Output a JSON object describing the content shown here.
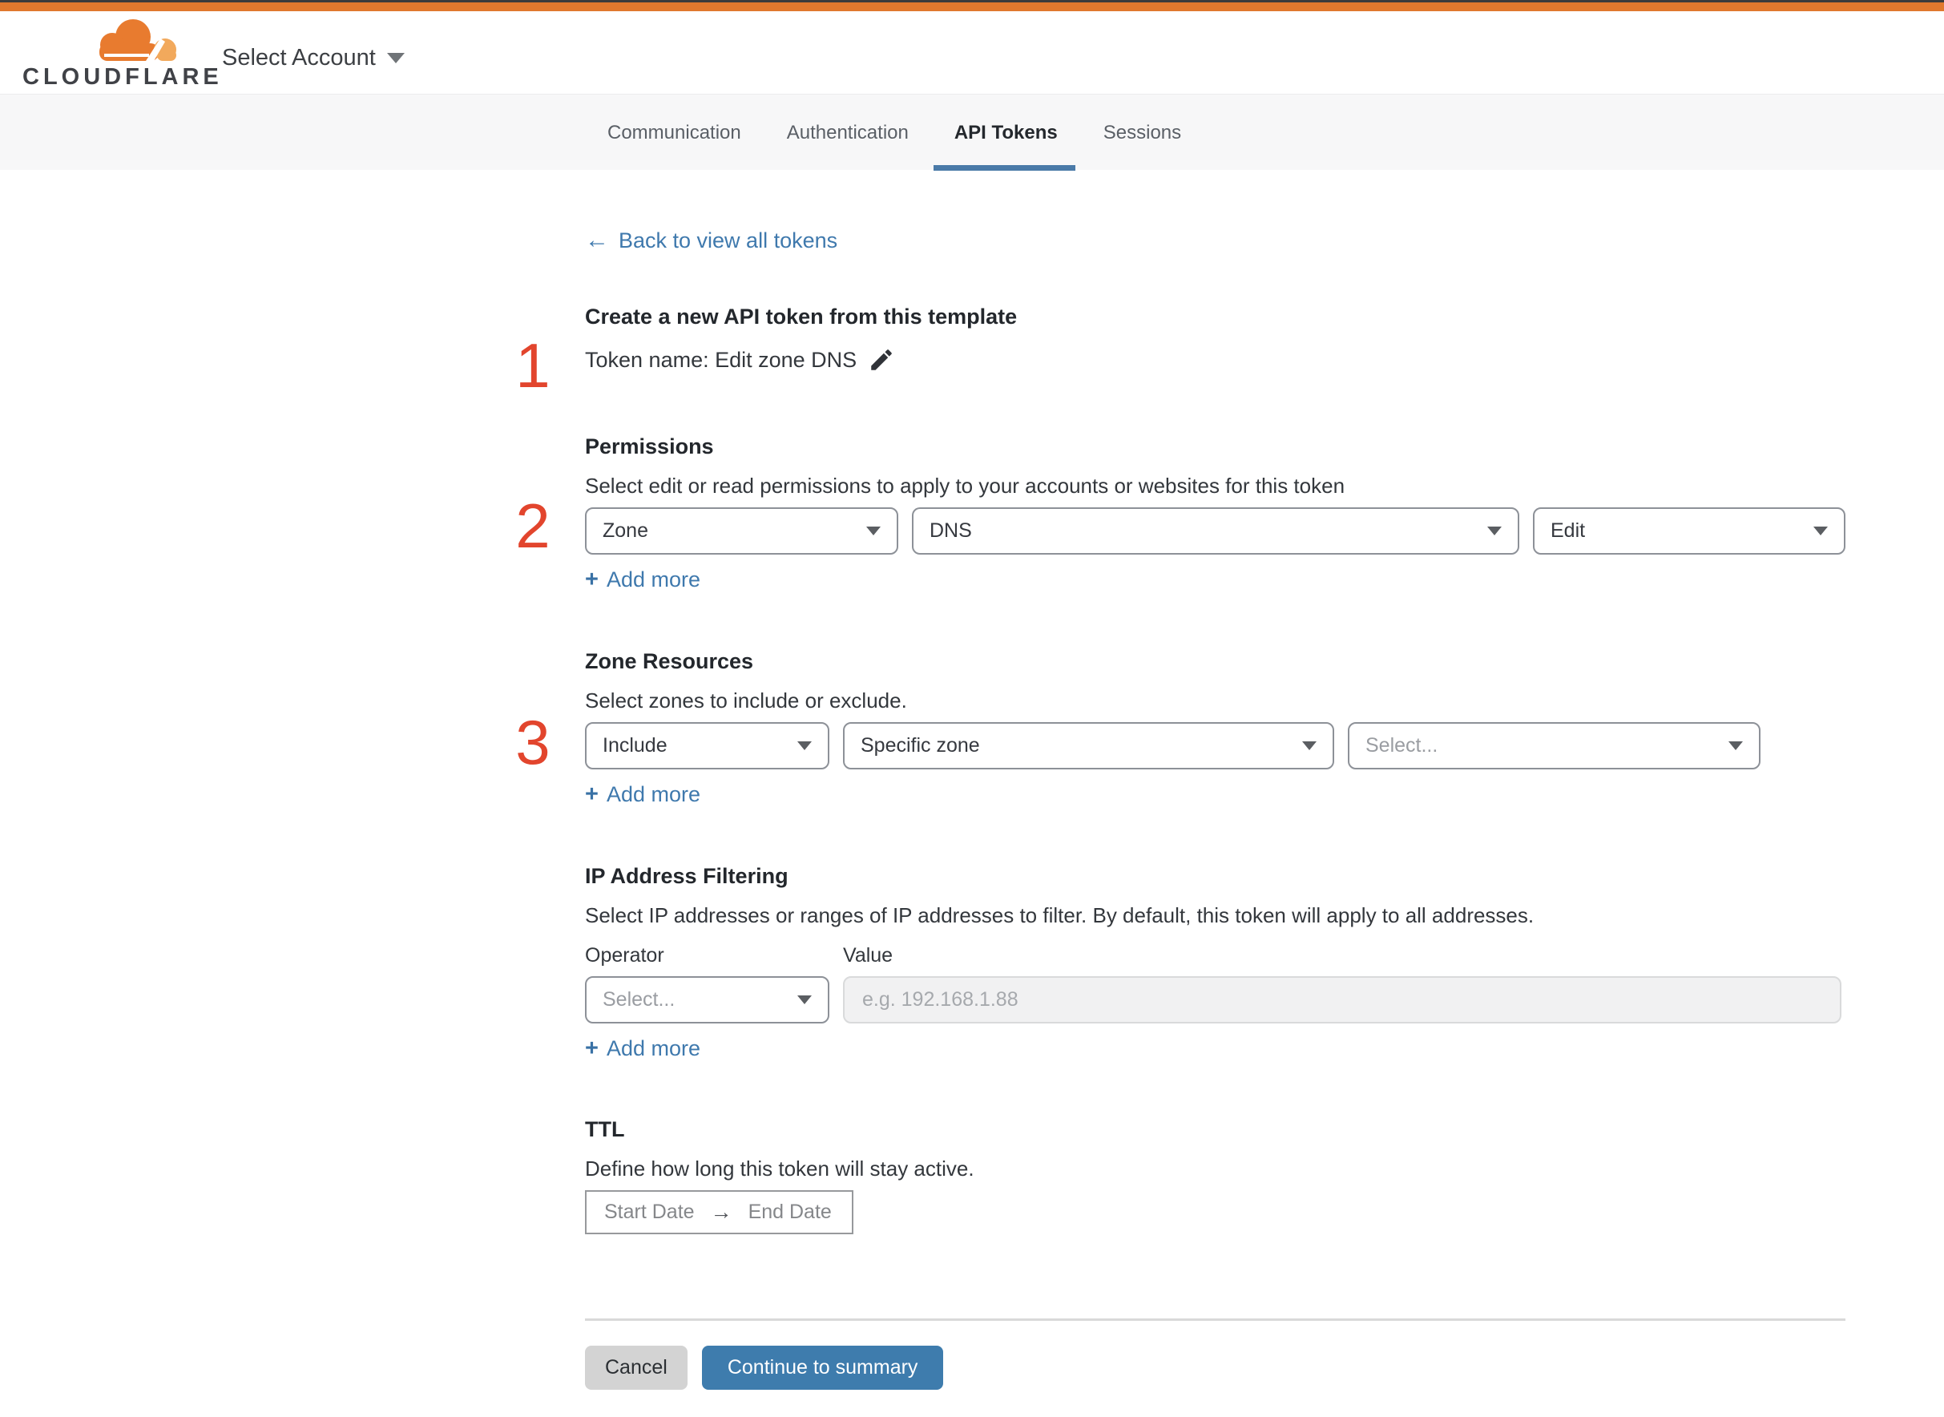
{
  "header": {
    "logo_text": "CLOUDFLARE",
    "account_selector_label": "Select Account"
  },
  "tabs": [
    {
      "label": "Communication",
      "active": false
    },
    {
      "label": "Authentication",
      "active": false
    },
    {
      "label": "API Tokens",
      "active": true
    },
    {
      "label": "Sessions",
      "active": false
    }
  ],
  "back_link": {
    "label": "Back to view all tokens"
  },
  "glyphs": {
    "back_arrow": "←",
    "plus": "+",
    "range_arrow": "→"
  },
  "token_section": {
    "step": "1",
    "title": "Create a new API token from this template",
    "token_name_line": "Token name: Edit zone DNS"
  },
  "permissions": {
    "step": "2",
    "title": "Permissions",
    "description": "Select edit or read permissions to apply to your accounts or websites for this token",
    "scope_value": "Zone",
    "resource_value": "DNS",
    "access_value": "Edit",
    "add_more_label": "Add more"
  },
  "zone_resources": {
    "step": "3",
    "title": "Zone Resources",
    "description": "Select zones to include or exclude.",
    "mode_value": "Include",
    "type_value": "Specific zone",
    "zone_placeholder": "Select...",
    "add_more_label": "Add more"
  },
  "ip_filtering": {
    "title": "IP Address Filtering",
    "description": "Select IP addresses or ranges of IP addresses to filter. By default, this token will apply to all addresses.",
    "operator_label": "Operator",
    "value_label": "Value",
    "operator_placeholder": "Select...",
    "value_placeholder": "e.g. 192.168.1.88",
    "add_more_label": "Add more"
  },
  "ttl": {
    "title": "TTL",
    "description": "Define how long this token will stay active.",
    "start_label": "Start Date",
    "end_label": "End Date"
  },
  "footer": {
    "cancel_label": "Cancel",
    "continue_label": "Continue to summary"
  },
  "colors": {
    "topbar_orange": "#e0782e",
    "brand_orange": "#e87b2f",
    "brand_orange_light": "#f2a95c",
    "accent_blue": "#3e7cad",
    "link_blue": "#3f79ad",
    "tab_underline": "#4a7aa8",
    "step_red": "#e2452d"
  }
}
